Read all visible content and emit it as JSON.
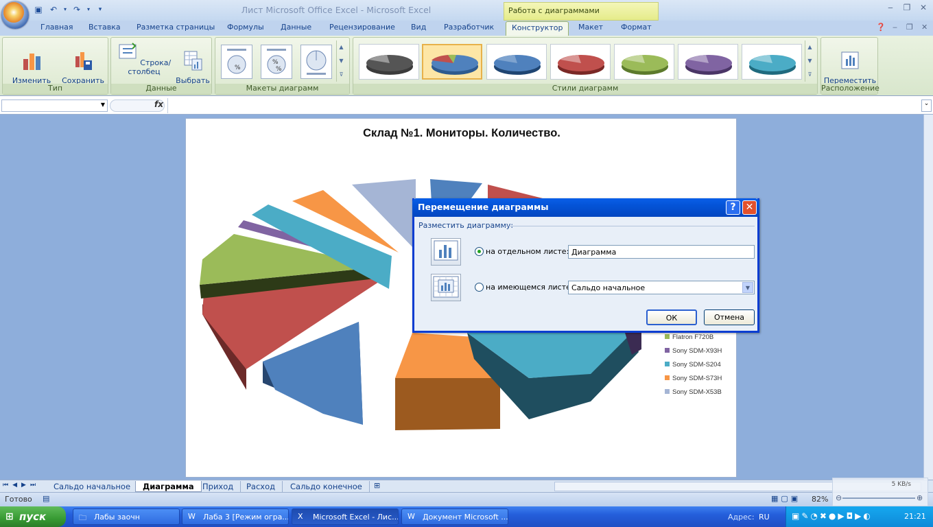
{
  "window": {
    "title": "Лист Microsoft Office Excel  -  Microsoft Excel",
    "context_tab_group": "Работа с диаграммами",
    "minimize": "‒",
    "restore": "❐",
    "close": "✕"
  },
  "ribbon_tabs": [
    "Главная",
    "Вставка",
    "Разметка страницы",
    "Формулы",
    "Данные",
    "Рецензирование",
    "Вид",
    "Разработчик",
    "Конструктор",
    "Макет",
    "Формат"
  ],
  "ribbon": {
    "groups": {
      "type": {
        "label": "Тип",
        "change_type": "Изменить тип\nдиаграммы",
        "save_template": "Сохранить\nкак шаблон"
      },
      "data": {
        "label": "Данные",
        "switch_row_col": "Строка/столбец",
        "select_data": "Выбрать\nданные"
      },
      "layouts": {
        "label": "Макеты диаграмм"
      },
      "styles": {
        "label": "Стили диаграмм"
      },
      "location": {
        "label": "Расположение",
        "move_chart": "Переместить\nдиаграмму"
      }
    }
  },
  "formula_bar": {
    "name_box": "",
    "fx": "fx",
    "formula": ""
  },
  "chart": {
    "colors": {
      "blue": "#4f81bd",
      "red": "#c0504d",
      "green": "#9bbb59",
      "purple": "#8064a2",
      "teal": "#4bacc6",
      "orange": "#f79646",
      "lavender": "#a5b5d5"
    }
  },
  "chart_data": {
    "type": "pie",
    "title": "Склад №1. Мониторы. Количество.",
    "legend_visible": [
      "Flatron  F720B",
      "Sony SDM-X93H",
      "Sony SDM-S204",
      "Sony SDM-S73H",
      "Sony SDM-X53B"
    ],
    "legend_colors": [
      "#9bbb59",
      "#8064a2",
      "#4bacc6",
      "#f79646",
      "#a5b5d5"
    ],
    "style": "3d-exploded-pie"
  },
  "dialog": {
    "title": "Перемещение диаграммы",
    "section_label": "Разместить диаграмму:",
    "option_new_sheet": "на отдельном листе:",
    "option_existing_sheet": "на имеющемся листе:",
    "new_sheet_name": "Диаграмма",
    "existing_sheet_value": "Сальдо начальное",
    "ok": "ОК",
    "cancel": "Отмена",
    "help": "?",
    "close": "✕"
  },
  "sheet_tabs": [
    "Сальдо начальное",
    "Диаграмма",
    "Приход",
    "Расход",
    "Сальдо конечное"
  ],
  "status": {
    "ready": "Готово",
    "zoom": "82%",
    "net_speed": "5 KB/s"
  },
  "taskbar": {
    "start": "пуск",
    "buttons": [
      "Лабы заочн",
      "Лаба 3 [Режим огра...",
      "Microsoft Excel - Лис...",
      "Документ Microsoft ..."
    ],
    "address_label": "Адрес:",
    "lang": "RU",
    "clock": "21:21"
  }
}
